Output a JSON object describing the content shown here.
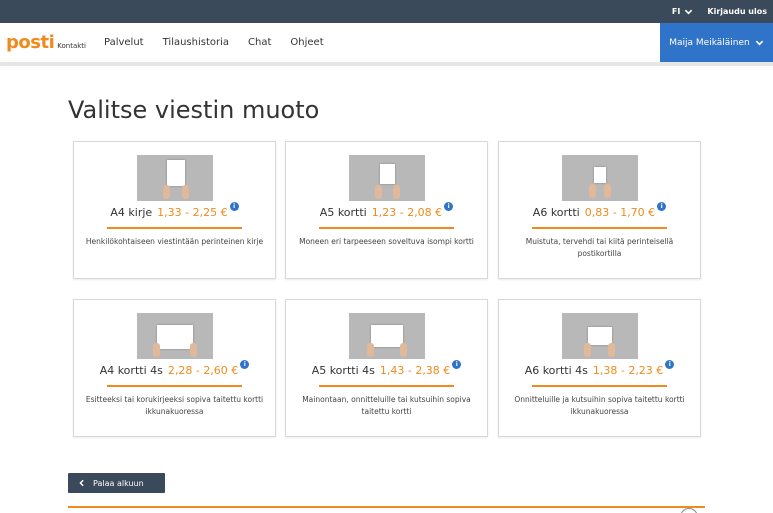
{
  "topbar": {
    "language": "FI",
    "logout": "Kirjaudu ulos"
  },
  "nav": {
    "logo": "posti",
    "logo_sub": "Kontakti",
    "links": [
      "Palvelut",
      "Tilaushistoria",
      "Chat",
      "Ohjeet"
    ],
    "user": "Maija Meikäläinen"
  },
  "page": {
    "title": "Valitse viestin muoto"
  },
  "cards": [
    {
      "name": "A4 kirje",
      "price": "1,33 - 2,25 €",
      "desc": "Henkilökohtaiseen viestintään perinteinen kirje"
    },
    {
      "name": "A5 kortti",
      "price": "1,23 - 2,08 €",
      "desc": "Moneen eri tarpeeseen soveltuva isompi kortti"
    },
    {
      "name": "A6 kortti",
      "price": "0,83 - 1,70 €",
      "desc": "Muistuta, tervehdi tai kiitä perinteisellä postikortilla"
    },
    {
      "name": "A4 kortti 4s",
      "price": "2,28 - 2,60 €",
      "desc": "Esitteeksi tai korukirjeeksi sopiva taitettu kortti ikkunakuoressa"
    },
    {
      "name": "A5 kortti 4s",
      "price": "1,43 - 2,38 €",
      "desc": "Mainontaan, onnitteluille tai kutsuihin sopiva taitettu kortti"
    },
    {
      "name": "A6 kortti 4s",
      "price": "1,38 - 2,23 €",
      "desc": "Onnitteluille ja kutsuihin sopiva taitettu kortti ikkunakuoressa"
    }
  ],
  "info_glyph": "i",
  "back_button": "Palaa alkuun",
  "colors": {
    "accent": "#f08a1c",
    "header": "#3b4a5a",
    "user_bg": "#2f74c8"
  }
}
